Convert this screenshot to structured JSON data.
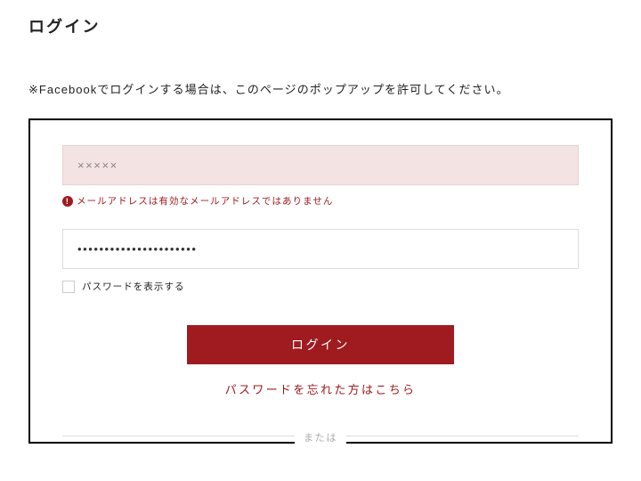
{
  "page": {
    "title": "ログイン",
    "notice": "※Facebookでログインする場合は、このページのポップアップを許可してください。"
  },
  "form": {
    "email": {
      "value": "×××××",
      "error": "メールアドレスは有効なメールアドレスではありません"
    },
    "password": {
      "value": "••••••••••••••••••••••"
    },
    "showPasswordLabel": "パスワードを表示する",
    "loginButton": "ログイン",
    "forgotPassword": "パスワードを忘れた方はこちら",
    "divider": "または"
  },
  "colors": {
    "accent": "#9f1b20",
    "errorBg": "#f4e3e3"
  }
}
